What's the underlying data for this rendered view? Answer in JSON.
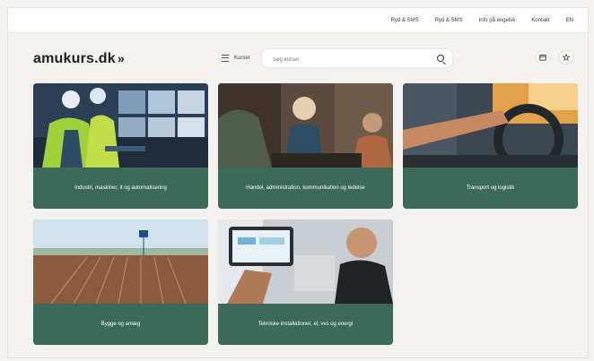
{
  "topbar": {
    "links": [
      "Ryd & SMS",
      "Ryd & SMS",
      "Info på engelsk",
      "Kontakt",
      "EN"
    ]
  },
  "header": {
    "logo_text": "amukurs.dk",
    "logo_chevron": "»",
    "menu_label": "Kurser",
    "search_placeholder": "Søg kurser",
    "icons": [
      "search-icon",
      "calendar-icon",
      "star-icon"
    ]
  },
  "cards": [
    {
      "label": "Industri, maskiner, it og automatisering"
    },
    {
      "label": "Handel, administration, kommunikation og ledelse"
    },
    {
      "label": "Transport og logistik"
    },
    {
      "label": "Bygge og anlæg"
    },
    {
      "label": "Tekniske installationer, el, vvs og energi"
    }
  ],
  "colors": {
    "card_band": "#3b6a5a",
    "background": "#f3f2ee"
  }
}
